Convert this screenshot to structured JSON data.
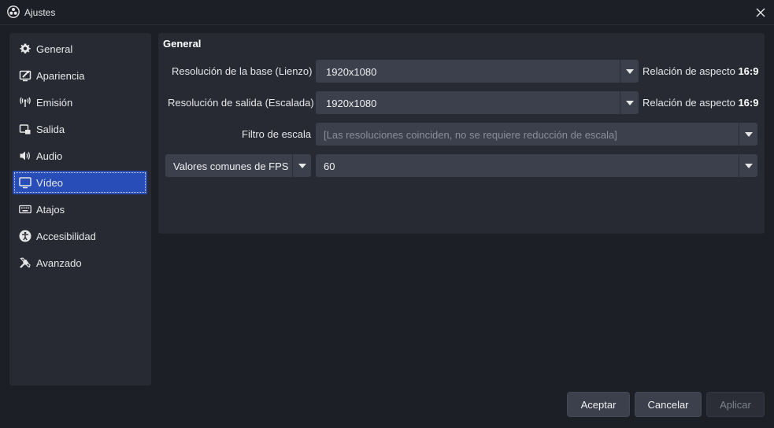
{
  "window": {
    "title": "Ajustes"
  },
  "sidebar": {
    "items": [
      {
        "label": "General",
        "icon": "gear-icon"
      },
      {
        "label": "Apariencia",
        "icon": "appearance-icon"
      },
      {
        "label": "Emisión",
        "icon": "broadcast-icon"
      },
      {
        "label": "Salida",
        "icon": "output-icon"
      },
      {
        "label": "Audio",
        "icon": "speaker-icon"
      },
      {
        "label": "Vídeo",
        "icon": "monitor-icon",
        "selected": true
      },
      {
        "label": "Atajos",
        "icon": "keyboard-icon"
      },
      {
        "label": "Accesibilidad",
        "icon": "accessibility-icon"
      },
      {
        "label": "Avanzado",
        "icon": "tools-icon"
      }
    ]
  },
  "video": {
    "section_title": "General",
    "base_resolution": {
      "label": "Resolución de la base (Lienzo)",
      "value": "1920x1080",
      "aspect_label": "Relación de aspecto",
      "aspect_value": "16:9"
    },
    "output_resolution": {
      "label": "Resolución de salida (Escalada)",
      "value": "1920x1080",
      "aspect_label": "Relación de aspecto",
      "aspect_value": "16:9"
    },
    "scale_filter": {
      "label": "Filtro de escala",
      "value": "[Las resoluciones coinciden, no se requiere reducción de escala]",
      "disabled": true
    },
    "fps": {
      "type_value": "Valores comunes de FPS",
      "value": "60"
    }
  },
  "buttons": {
    "accept": "Aceptar",
    "cancel": "Cancelar",
    "apply": "Aplicar"
  },
  "colors": {
    "background": "#1d1f26",
    "panel": "#272a33",
    "control": "#3c404d",
    "accent": "#284cb8"
  }
}
